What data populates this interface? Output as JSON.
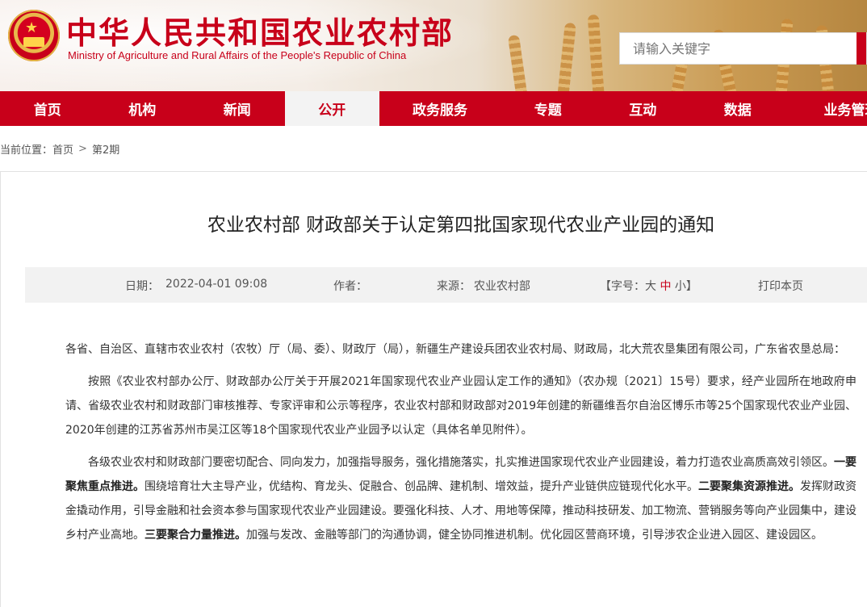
{
  "header": {
    "title": "中华人民共和国农业农村部",
    "subtitle": "Ministry of Agriculture and Rural Affairs of the People's Republic of China",
    "search_placeholder": "请输入关键字"
  },
  "nav": {
    "items": [
      "首页",
      "机构",
      "新闻",
      "公开",
      "政务服务",
      "专题",
      "互动",
      "数据",
      "业务管理"
    ],
    "active_index": 3
  },
  "breadcrumb": {
    "prefix": "当前位置：",
    "home": "首页",
    "separator": ">",
    "current": "第2期"
  },
  "article": {
    "title": "农业农村部 财政部关于认定第四批国家现代农业产业园的通知",
    "meta": {
      "date_label": "日期：",
      "date": "2022-04-01 09:08",
      "author_label": "作者：",
      "source_label": "来源：",
      "source": "农业农村部",
      "font_prefix": "【字号：",
      "font_large": "大",
      "font_medium": "中",
      "font_small": "小",
      "font_suffix": "】",
      "print": "打印本页"
    },
    "p1": "各省、自治区、直辖市农业农村（农牧）厅（局、委）、财政厅（局），新疆生产建设兵团农业农村局、财政局，北大荒农垦集团有限公司，广东省农垦总局：",
    "p2": "按照《农业农村部办公厅、财政部办公厅关于开展2021年国家现代农业产业园认定工作的通知》（农办规〔2021〕15号）要求，经产业园所在地政府申请、省级农业农村和财政部门审核推荐、专家评审和公示等程序，农业农村部和财政部对2019年创建的新疆维吾尔自治区博乐市等25个国家现代农业产业园、2020年创建的江苏省苏州市吴江区等18个国家现代农业产业园予以认定（具体名单见附件）。",
    "p3_a": "各级农业农村和财政部门要密切配合、同向发力，加强指导服务，强化措施落实，扎实推进国家现代农业产业园建设，着力打造农业高质高效引领区。",
    "p3_b1": "一要聚焦重点推进。",
    "p3_c": "围绕培育壮大主导产业，优结构、育龙头、促融合、创品牌、建机制、增效益，提升产业链供应链现代化水平。",
    "p3_b2": "二要聚集资源推进。",
    "p3_d": "发挥财政资金撬动作用，引导金融和社会资本参与国家现代农业产业园建设。要强化科技、人才、用地等保障，推动科技研发、加工物流、营销服务等向产业园集中，建设乡村产业高地。",
    "p3_b3": "三要聚合力量推进。",
    "p3_e": "加强与发改、金融等部门的沟通协调，健全协同推进机制。优化园区营商环境，引导涉农企业进入园区、建设园区。"
  },
  "colors": {
    "brand_red": "#c8001a",
    "meta_bg": "#f2f2f2"
  }
}
